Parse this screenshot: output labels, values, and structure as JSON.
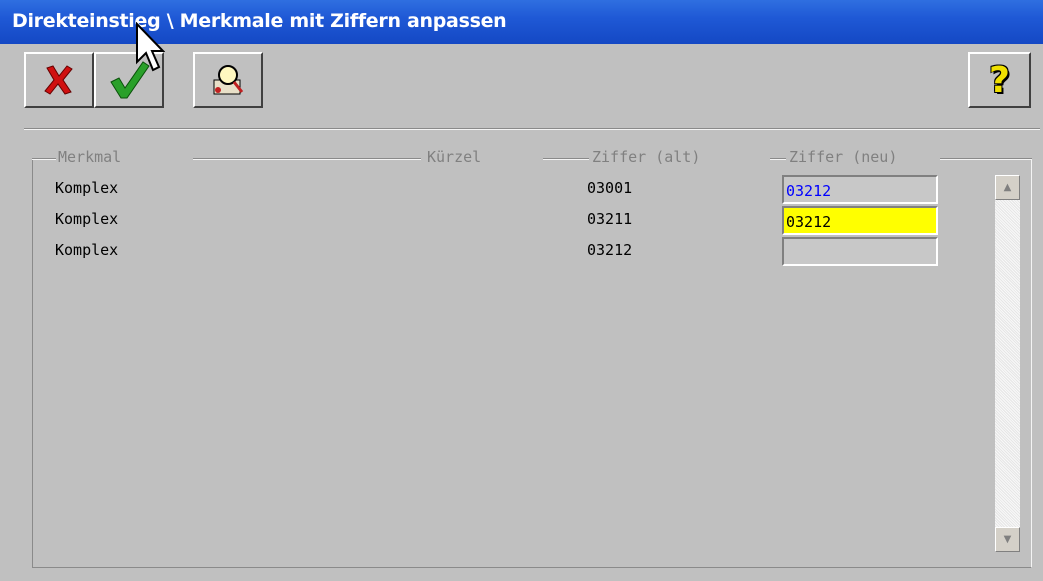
{
  "window": {
    "title": "Direkteinstieg \\ Merkmale mit Ziffern anpassen"
  },
  "toolbar": {
    "cancel_icon": "red-x-icon",
    "ok_icon": "green-check-icon",
    "search_icon": "magnifier-icon",
    "help_label": "?"
  },
  "table": {
    "headers": {
      "merkmal": "Merkmal",
      "kuerzel": "Kürzel",
      "ziffer_alt": "Ziffer (alt)",
      "ziffer_neu": "Ziffer (neu)"
    },
    "rows": [
      {
        "merkmal": "Komplex",
        "ziffer_alt": "03001",
        "ziffer_neu": "03212"
      },
      {
        "merkmal": "Komplex",
        "ziffer_alt": "03211",
        "ziffer_neu": "03212"
      },
      {
        "merkmal": "Komplex",
        "ziffer_alt": "03212",
        "ziffer_neu": ""
      }
    ]
  },
  "colors": {
    "titlebar": "#1f59d6",
    "active_field": "#ffff00",
    "field_text": "#0000ff"
  }
}
